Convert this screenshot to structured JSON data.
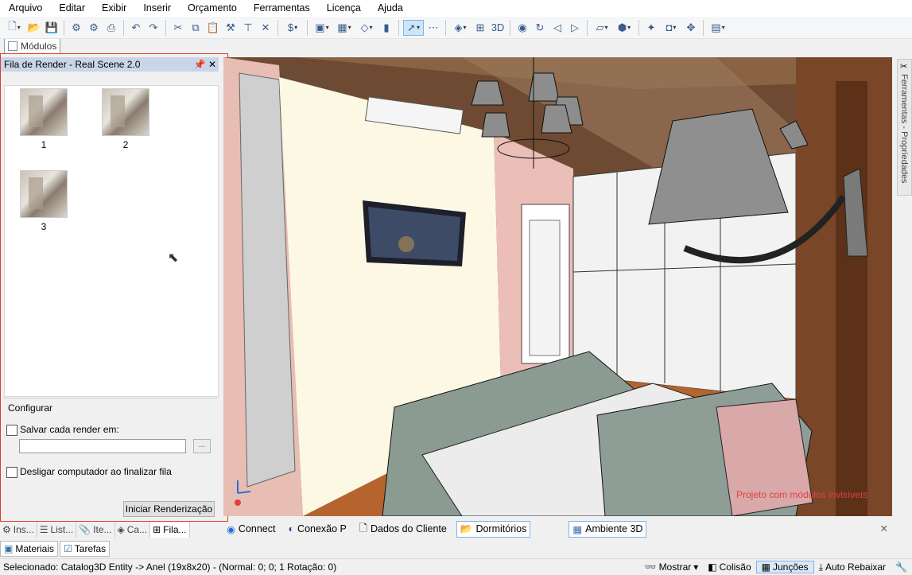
{
  "menu": [
    "Arquivo",
    "Editar",
    "Exibir",
    "Inserir",
    "Orçamento",
    "Ferramentas",
    "Licença",
    "Ajuda"
  ],
  "modules_tab": "Módulos",
  "panel": {
    "title": "Fila de Render - Real Scene 2.0",
    "thumbnails": [
      "1",
      "2",
      "3"
    ],
    "config_label": "Configurar",
    "save_label": "Salvar cada render em:",
    "path_value": "",
    "browse_label": "...",
    "shutdown_label": "Desligar computador ao finalizar fila",
    "start_button": "Iniciar Renderização",
    "tabs": [
      "Ins...",
      "List...",
      "Ite...",
      "Ca...",
      "Fila..."
    ]
  },
  "viewport": {
    "overlay_text": "Projeto com módulos invisíveis"
  },
  "side_tab": "Ferramentas - Propriedades",
  "doc_tabs": [
    "Connect",
    "Conexão P",
    "Dados do Cliente",
    "Dormitórios",
    "Ambiente 3D"
  ],
  "bottom_tabs": [
    "Materiais",
    "Tarefas"
  ],
  "status": {
    "message": "Selecionado: Catalog3D Entity -> Anel (19x8x20) - (Normal: 0; 0; 1 Rotação: 0)",
    "items": [
      "Mostrar",
      "Colisão",
      "Junções",
      "Auto Rebaixar"
    ]
  },
  "colors": {
    "highlight_border": "#e0392b",
    "panel_header": "#c9d6e8",
    "selected_tab_border": "#7eb4ea",
    "overlay_text": "#e04040"
  }
}
